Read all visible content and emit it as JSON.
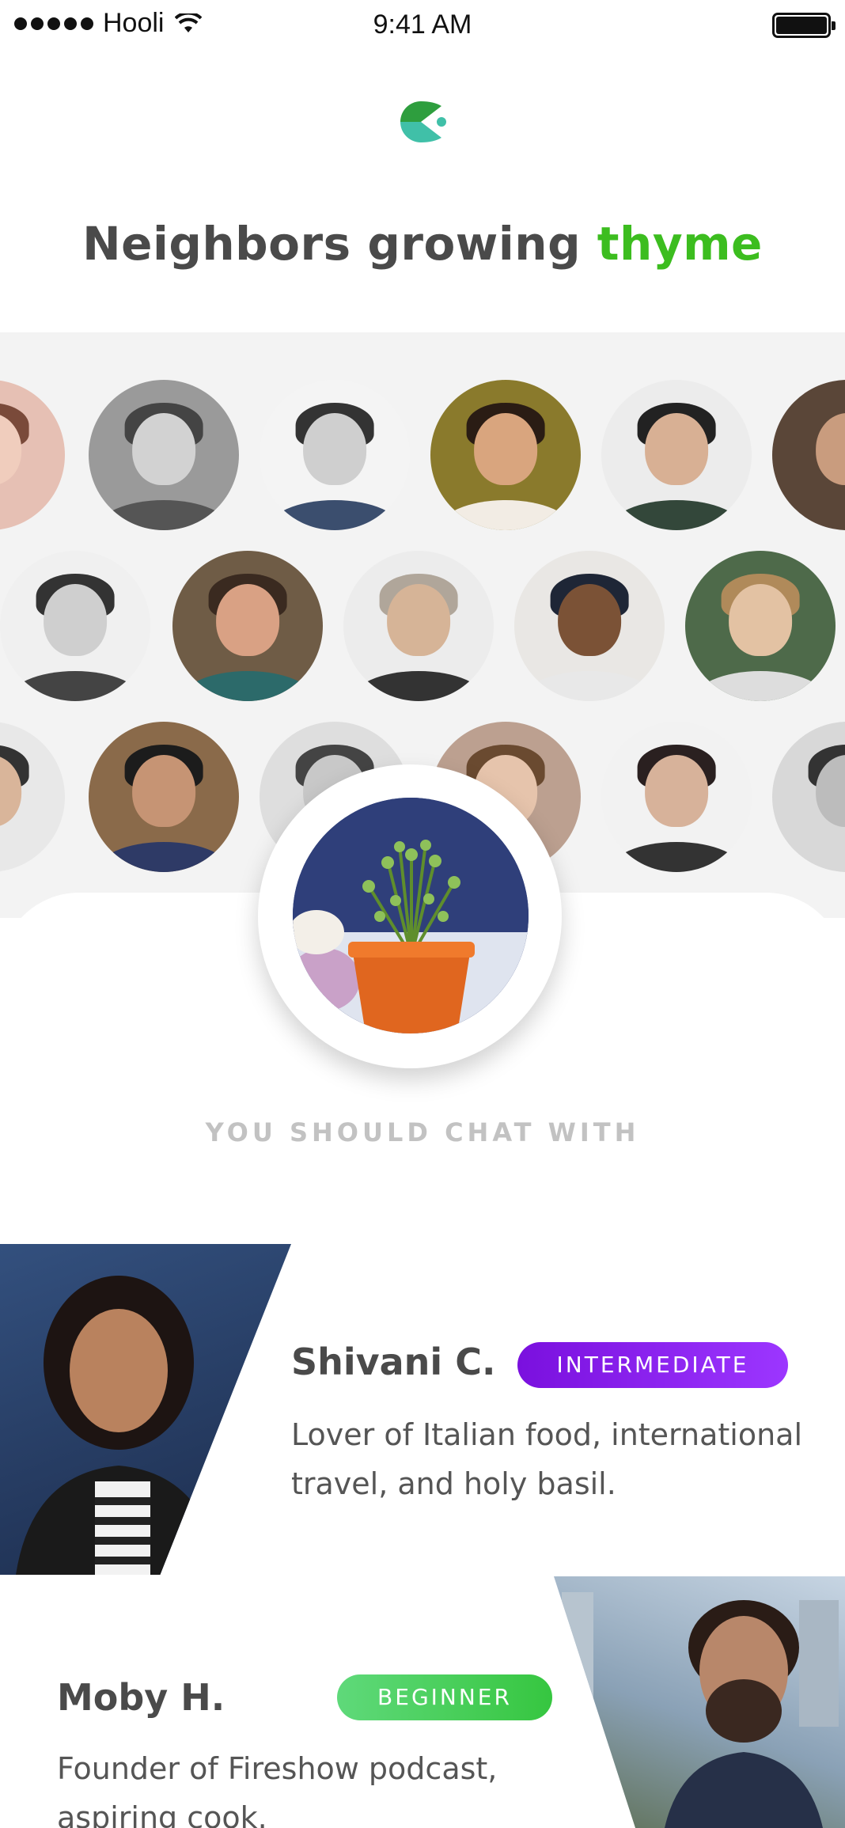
{
  "status_bar": {
    "carrier": "Hooli",
    "time": "9:41 AM"
  },
  "header": {
    "title_prefix": "Neighbors growing",
    "title_accent": "thyme"
  },
  "colors": {
    "accent_green": "#3cbd1f",
    "badge_purple": "#8a1ff0",
    "badge_green": "#4ad25a",
    "logo_green": "#2e9e3e",
    "logo_teal": "#40c0a8"
  },
  "avatar_wall": {
    "icon": "neighbor-avatar-icon",
    "count": 17
  },
  "featured": {
    "icon": "thyme-plant-icon"
  },
  "section_label": "YOU SHOULD CHAT WITH",
  "suggestions": [
    {
      "name": "Shivani C.",
      "level": "INTERMEDIATE",
      "bio_line1": "Lover of Italian food, international",
      "bio_line2": "travel, and holy basil."
    },
    {
      "name": "Moby H.",
      "level": "BEGINNER",
      "bio_line1": "Founder of Fireshow podcast,",
      "bio_line2": "aspiring cook."
    }
  ]
}
